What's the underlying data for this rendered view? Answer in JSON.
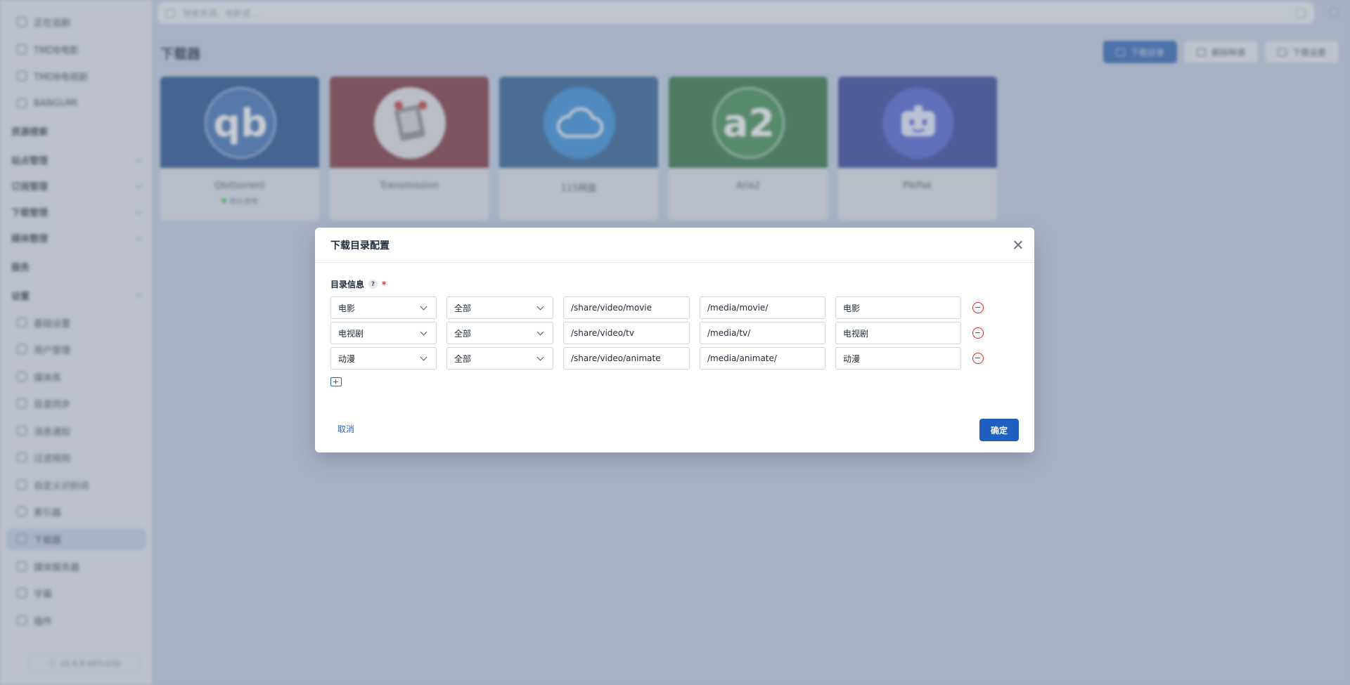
{
  "sidebar": {
    "items": [
      {
        "label": "正在追剧",
        "type": "sub",
        "icon": "calendar-icon"
      },
      {
        "label": "TMDB电影",
        "type": "sub",
        "icon": "film-icon"
      },
      {
        "label": "TMDB电视剧",
        "type": "sub",
        "icon": "tv-icon"
      },
      {
        "label": "BANGUMI",
        "type": "sub",
        "icon": "bangumi-icon"
      },
      {
        "label": "资源搜索",
        "type": "group",
        "icon": ""
      },
      {
        "label": "站点管理",
        "type": "group",
        "icon": ""
      },
      {
        "label": "订阅管理",
        "type": "group",
        "icon": ""
      },
      {
        "label": "下载管理",
        "type": "group",
        "icon": ""
      },
      {
        "label": "媒体整理",
        "type": "group",
        "icon": ""
      },
      {
        "label": "服务",
        "type": "group",
        "icon": ""
      },
      {
        "label": "设置",
        "type": "group",
        "icon": ""
      },
      {
        "label": "基础设置",
        "type": "sub",
        "icon": "gear-icon"
      },
      {
        "label": "用户管理",
        "type": "sub",
        "icon": "user-icon"
      },
      {
        "label": "媒体库",
        "type": "sub",
        "icon": "library-icon"
      },
      {
        "label": "目录同步",
        "type": "sub",
        "icon": "sync-icon"
      },
      {
        "label": "消息通知",
        "type": "sub",
        "icon": "bell-icon"
      },
      {
        "label": "过滤规则",
        "type": "sub",
        "icon": "filter-icon"
      },
      {
        "label": "自定义识别词",
        "type": "sub",
        "icon": "code-icon"
      },
      {
        "label": "索引器",
        "type": "sub",
        "icon": "search-icon"
      },
      {
        "label": "下载器",
        "type": "sub",
        "icon": "download-icon"
      },
      {
        "label": "媒体服务器",
        "type": "sub",
        "icon": "server-icon"
      },
      {
        "label": "字幕",
        "type": "sub",
        "icon": "subtitle-icon"
      },
      {
        "label": "插件",
        "type": "sub",
        "icon": "plugin-icon"
      }
    ],
    "version": "v2.9.9 a97c23b"
  },
  "header": {
    "search_placeholder": "搜索资源、电影或..."
  },
  "page": {
    "title": "下载器",
    "buttons": {
      "download_dir": "下载目录",
      "delete_record": "删除种源",
      "download_settings": "下载设置"
    }
  },
  "downloaders": [
    {
      "name": "Qbittorrent",
      "logo_text": "qb",
      "status": "默认使用",
      "banner_color": "#1f4c8e",
      "logo_color": "#3d70b8"
    },
    {
      "name": "Transmission",
      "logo_text": "",
      "status": "",
      "banner_color": "#7c2f38",
      "logo_color": "#e7e7e7"
    },
    {
      "name": "115网盘",
      "logo_text": "",
      "status": "",
      "banner_color": "#2b5d94",
      "logo_color": "#2f8fe0"
    },
    {
      "name": "Aria2",
      "logo_text": "a2",
      "status": "",
      "banner_color": "#2f7444",
      "logo_color": "#3e8d50"
    },
    {
      "name": "PikPak",
      "logo_text": "",
      "status": "",
      "banner_color": "#2d3f99",
      "logo_color": "#4a5fd6"
    }
  ],
  "dialog": {
    "title": "下载目录配置",
    "field_label": "目录信息",
    "required_mark": "*",
    "help_mark": "?",
    "rows": [
      {
        "media_type": "电影",
        "category": "全部",
        "download_path": "/share/video/movie",
        "library_path": "/media/movie/",
        "label": "电影"
      },
      {
        "media_type": "电视剧",
        "category": "全部",
        "download_path": "/share/video/tv",
        "library_path": "/media/tv/",
        "label": "电视剧"
      },
      {
        "media_type": "动漫",
        "category": "全部",
        "download_path": "/share/video/animate",
        "library_path": "/media/animate/",
        "label": "动漫"
      }
    ],
    "cancel_label": "取消",
    "confirm_label": "确定"
  },
  "colors": {
    "accent": "#1f5fbf",
    "danger": "#dc2626"
  }
}
